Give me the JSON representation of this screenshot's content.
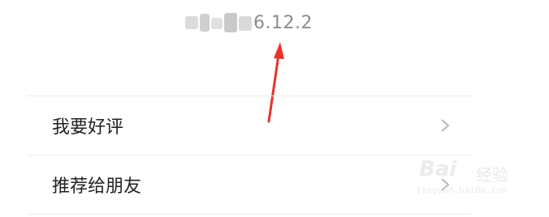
{
  "about": {
    "version": "6.12.2"
  },
  "menu": {
    "items": [
      {
        "label": "我要好评"
      },
      {
        "label": "推荐给朋友"
      }
    ]
  },
  "watermark": {
    "logo": "Bai",
    "sub": "经验",
    "url": "jingyan.baidu.com"
  },
  "colors": {
    "arrow": "#e8322b",
    "divider": "#ececec",
    "text": "#222222",
    "version_text": "#8c8c8c"
  },
  "icons": {
    "chevron": "chevron-right-icon",
    "annotation": "red-arrow-annotation"
  }
}
